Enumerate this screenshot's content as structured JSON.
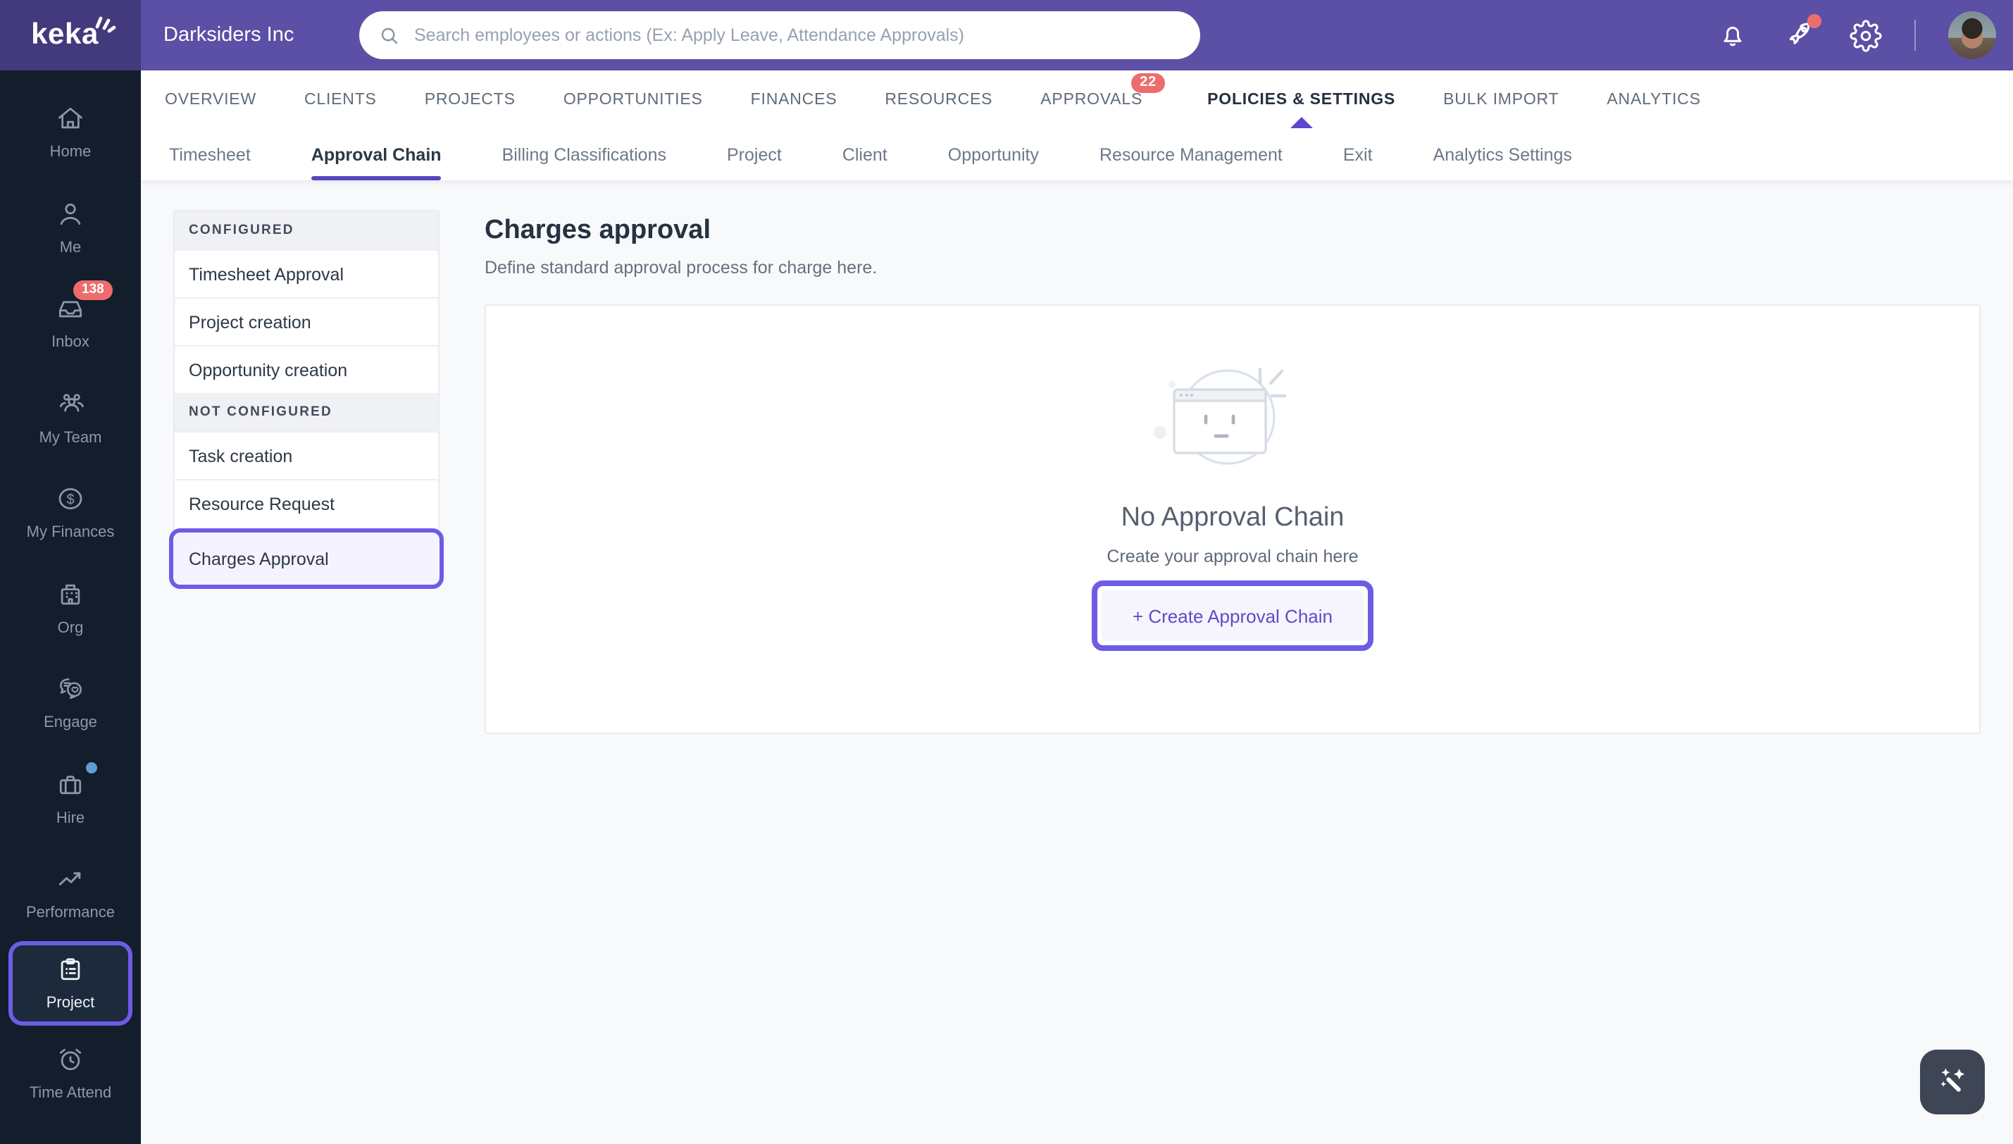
{
  "topbar": {
    "brand": "keka",
    "company": "Darksiders Inc",
    "search_placeholder": "Search employees or actions (Ex: Apply Leave, Attendance Approvals)"
  },
  "sidebar": {
    "items": [
      {
        "label": "Home"
      },
      {
        "label": "Me"
      },
      {
        "label": "Inbox",
        "badge": "138"
      },
      {
        "label": "My Team"
      },
      {
        "label": "My Finances"
      },
      {
        "label": "Org"
      },
      {
        "label": "Engage"
      },
      {
        "label": "Hire"
      },
      {
        "label": "Performance"
      },
      {
        "label": "Project",
        "active": true
      },
      {
        "label": "Time Attend"
      }
    ]
  },
  "main_nav": {
    "items": [
      {
        "label": "OVERVIEW"
      },
      {
        "label": "CLIENTS"
      },
      {
        "label": "PROJECTS"
      },
      {
        "label": "OPPORTUNITIES"
      },
      {
        "label": "FINANCES"
      },
      {
        "label": "RESOURCES"
      },
      {
        "label": "APPROVALS",
        "badge": "22"
      },
      {
        "label": "POLICIES & SETTINGS",
        "active": true
      },
      {
        "label": "BULK IMPORT"
      },
      {
        "label": "ANALYTICS"
      }
    ]
  },
  "sub_nav": {
    "items": [
      {
        "label": "Timesheet"
      },
      {
        "label": "Approval Chain",
        "active": true
      },
      {
        "label": "Billing Classifications"
      },
      {
        "label": "Project"
      },
      {
        "label": "Client"
      },
      {
        "label": "Opportunity"
      },
      {
        "label": "Resource Management"
      },
      {
        "label": "Exit"
      },
      {
        "label": "Analytics Settings"
      }
    ]
  },
  "approval_panel": {
    "sections": [
      {
        "header": "CONFIGURED",
        "items": [
          {
            "label": "Timesheet Approval"
          },
          {
            "label": "Project creation"
          },
          {
            "label": "Opportunity creation"
          }
        ]
      },
      {
        "header": "NOT CONFIGURED",
        "items": [
          {
            "label": "Task creation"
          },
          {
            "label": "Resource Request"
          },
          {
            "label": "Charges Approval",
            "highlighted": true
          }
        ]
      }
    ]
  },
  "page": {
    "title": "Charges approval",
    "subtitle": "Define standard approval process for charge here."
  },
  "empty_state": {
    "title": "No Approval Chain",
    "caption": "Create your approval chain here",
    "button_label": "+ Create Approval Chain"
  },
  "colors": {
    "accent_annotation": "#6c5ce7",
    "topbar": "#5b50a5",
    "logo_block": "#423a7d",
    "sidebar": "#131d2c",
    "badge_red": "#ed6c6c",
    "active_indicator": "#5a48cf"
  }
}
